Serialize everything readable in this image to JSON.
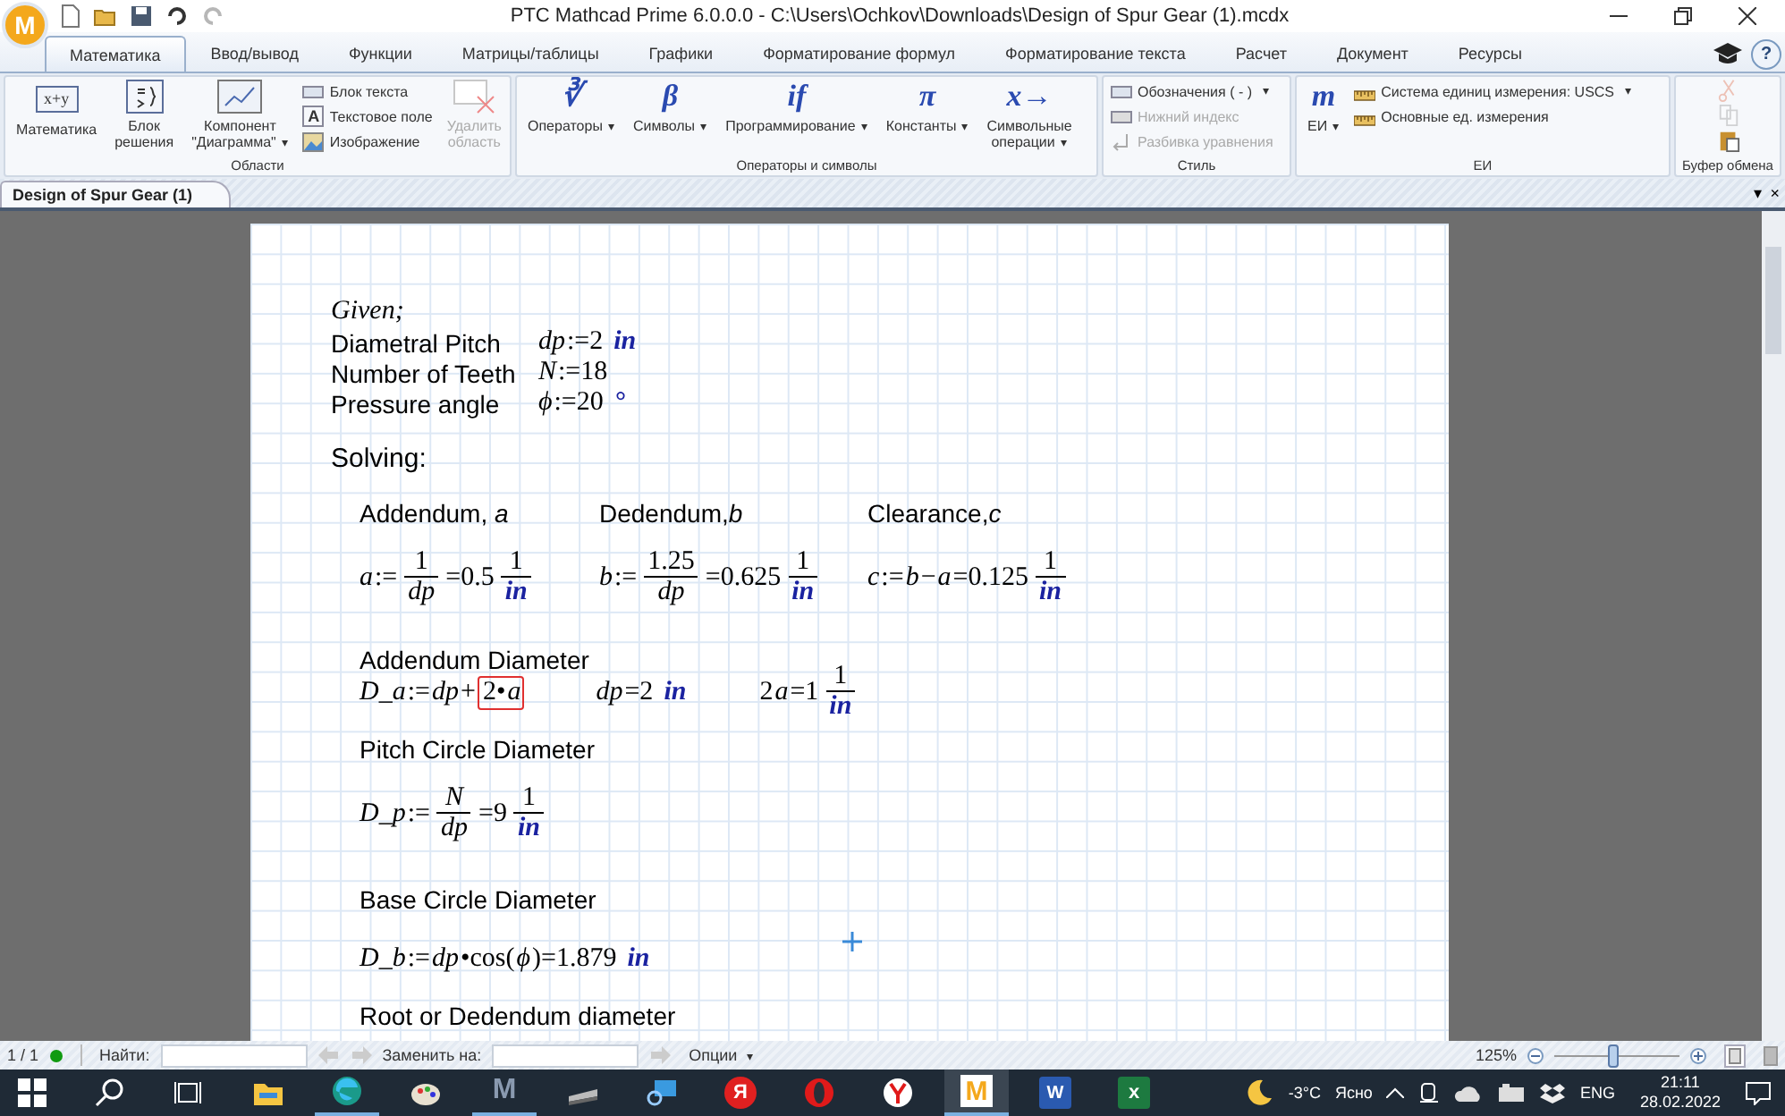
{
  "title_bar": {
    "app_logo": "M",
    "title": "PTC Mathcad Prime 6.0.0.0 - C:\\Users\\Ochkov\\Downloads\\Design of Spur Gear (1).mcdx",
    "quick_access": [
      {
        "kind": "new",
        "disabled": false
      },
      {
        "kind": "open",
        "disabled": false
      },
      {
        "kind": "save",
        "disabled": false
      },
      {
        "kind": "undo",
        "disabled": false
      },
      {
        "kind": "redo",
        "disabled": true
      }
    ]
  },
  "ribbon_tabs": [
    {
      "label": "Математика",
      "selected": true
    },
    {
      "label": "Ввод/вывод",
      "selected": false
    },
    {
      "label": "Функции",
      "selected": false
    },
    {
      "label": "Матрицы/таблицы",
      "selected": false
    },
    {
      "label": "Графики",
      "selected": false
    },
    {
      "label": "Форматирование формул",
      "selected": false
    },
    {
      "label": "Форматирование текста",
      "selected": false
    },
    {
      "label": "Расчет",
      "selected": false
    },
    {
      "label": "Документ",
      "selected": false
    },
    {
      "label": "Ресурсы",
      "selected": false
    }
  ],
  "help": "?",
  "ribbon_groups": [
    {
      "title": "Области",
      "items": [
        {
          "kind": "large",
          "label": "Математика",
          "glyph": "x+y",
          "disabled": false
        },
        {
          "kind": "large",
          "label": "Блок\nрешения",
          "disabled": false
        },
        {
          "kind": "large",
          "label": "Компонент\n\"Диаграмма\"",
          "caret": "▾",
          "disabled": false
        },
        {
          "kind": "small",
          "rows": [
            {
              "label": "Блок текста",
              "disabled": false
            },
            {
              "label": "Текстовое поле",
              "glyph": "A",
              "disabled": false
            },
            {
              "label": "Изображение",
              "disabled": false
            }
          ]
        },
        {
          "kind": "large",
          "label": "Удалить\nобласть",
          "disabled": true
        }
      ]
    },
    {
      "title": "Операторы и символы",
      "items": [
        {
          "kind": "large",
          "label": "Операторы",
          "glyph": "∛",
          "caret": "▾",
          "disabled": false
        },
        {
          "kind": "large",
          "label": "Символы",
          "glyph": "β",
          "caret": "▾",
          "disabled": false
        },
        {
          "kind": "large",
          "label": "Программирование",
          "glyph": "if",
          "caret": "▾",
          "disabled": false
        },
        {
          "kind": "large",
          "label": "Константы",
          "glyph": "π",
          "caret": "▾",
          "disabled": false
        },
        {
          "kind": "large",
          "label": "Символьные\nоперации",
          "glyph": "x→",
          "caret": "▾",
          "disabled": false
        }
      ]
    },
    {
      "title": "Стиль",
      "items": [
        {
          "kind": "small",
          "rows": [
            {
              "label": "Обозначения  ( - )",
              "caret": "▾",
              "disabled": false
            },
            {
              "label": "Нижний индекс",
              "disabled": true
            },
            {
              "label": "Разбивка уравнения",
              "disabled": true
            }
          ]
        }
      ]
    },
    {
      "title": "ЕИ",
      "items": [
        {
          "kind": "large",
          "label": "ЕИ",
          "glyph": "m",
          "caret": "▾",
          "disabled": false
        },
        {
          "kind": "small",
          "rows": [
            {
              "label": "Система единиц измерения:  USCS",
              "caret": "▾",
              "disabled": false
            },
            {
              "label": "Основные ед. измерения",
              "disabled": false
            }
          ]
        }
      ]
    },
    {
      "title": "Буфер обмена",
      "items": [
        {
          "kind": "icons",
          "rows": [
            {
              "disabled": true
            },
            {
              "disabled": true
            },
            {
              "disabled": false
            }
          ]
        }
      ]
    }
  ],
  "document_tabs": [
    {
      "label": "Design of Spur Gear (1)",
      "selected": true
    }
  ],
  "document_tab_menu": "▾",
  "document_tab_close": "×",
  "worksheet": {
    "blocks": [
      {
        "kind": "given",
        "text": "Given;"
      },
      {
        "kind": "definitions",
        "rows": [
          {
            "label": "Diametral Pitch",
            "expr": [
              {
                "kind": "var",
                "text": "dp"
              },
              {
                "kind": "num",
                "text": ":=2"
              },
              {
                "kind": "unit",
                "text": "in"
              }
            ]
          },
          {
            "label": "Number of Teeth",
            "expr": [
              {
                "kind": "var",
                "text": "N"
              },
              {
                "kind": "num",
                "text": ":=18"
              }
            ]
          },
          {
            "label": "Pressure angle",
            "expr": [
              {
                "kind": "var",
                "text": "ϕ"
              },
              {
                "kind": "num",
                "text": ":=20"
              },
              {
                "kind": "unit",
                "text": "°"
              }
            ]
          }
        ]
      },
      {
        "kind": "heading",
        "text": "Solving:"
      },
      {
        "kind": "columns",
        "columns": [
          {
            "title": "Addendum, *a*",
            "expr": [
              {
                "kind": "var",
                "text": "a"
              },
              {
                "kind": "num",
                "text": ":="
              },
              {
                "kind": "frac",
                "num": {
                  "kind": "num",
                  "text": "1"
                },
                "den": {
                  "kind": "var",
                  "text": "dp"
                }
              },
              {
                "kind": "num",
                "text": "=0.5"
              },
              {
                "kind": "frac",
                "num": {
                  "kind": "num",
                  "text": "1"
                },
                "den": {
                  "kind": "unit",
                  "text": "in"
                }
              }
            ]
          },
          {
            "title": "Dedendum,*b*",
            "expr": [
              {
                "kind": "var",
                "text": "b"
              },
              {
                "kind": "num",
                "text": ":="
              },
              {
                "kind": "frac",
                "num": {
                  "kind": "num",
                  "text": "1.25"
                },
                "den": {
                  "kind": "var",
                  "text": "dp"
                }
              },
              {
                "kind": "num",
                "text": "=0.625"
              },
              {
                "kind": "frac",
                "num": {
                  "kind": "num",
                  "text": "1"
                },
                "den": {
                  "kind": "unit",
                  "text": "in"
                }
              }
            ]
          },
          {
            "title": "Clearance,*c*",
            "expr": [
              {
                "kind": "var",
                "text": "c"
              },
              {
                "kind": "num",
                "text": ":="
              },
              {
                "kind": "var",
                "text": "b"
              },
              {
                "kind": "num",
                "text": "−"
              },
              {
                "kind": "var",
                "text": "a"
              },
              {
                "kind": "num",
                "text": "=0.125"
              },
              {
                "kind": "frac",
                "num": {
                  "kind": "num",
                  "text": "1"
                },
                "den": {
                  "kind": "unit",
                  "text": "in"
                }
              }
            ]
          }
        ]
      },
      {
        "kind": "section",
        "title": "Addendum Diameter",
        "exprs": [
          [
            {
              "kind": "var",
              "text": "D_a"
            },
            {
              "kind": "num",
              "text": ":="
            },
            {
              "kind": "var",
              "text": "dp"
            },
            {
              "kind": "num",
              "text": "+"
            },
            {
              "kind": "box",
              "items": [
                {
                  "kind": "num",
                  "text": "2•"
                },
                {
                  "kind": "var",
                  "text": "a"
                }
              ]
            }
          ],
          [
            {
              "kind": "var",
              "text": "dp"
            },
            {
              "kind": "num",
              "text": "=2"
            },
            {
              "kind": "unit",
              "text": "in"
            }
          ],
          [
            {
              "kind": "num",
              "text": "2 "
            },
            {
              "kind": "var",
              "text": "a"
            },
            {
              "kind": "num",
              "text": "=1"
            },
            {
              "kind": "frac",
              "num": {
                "kind": "num",
                "text": "1"
              },
              "den": {
                "kind": "unit",
                "text": "in"
              }
            }
          ]
        ]
      },
      {
        "kind": "section",
        "title": "Pitch Circle Diameter",
        "exprs": [
          [
            {
              "kind": "var",
              "text": "D_p"
            },
            {
              "kind": "num",
              "text": ":="
            },
            {
              "kind": "frac",
              "num": {
                "kind": "var",
                "text": "N"
              },
              "den": {
                "kind": "var",
                "text": "dp"
              }
            },
            {
              "kind": "num",
              "text": "=9"
            },
            {
              "kind": "frac",
              "num": {
                "kind": "num",
                "text": "1"
              },
              "den": {
                "kind": "unit",
                "text": "in"
              }
            }
          ]
        ]
      },
      {
        "kind": "section",
        "title": "Base Circle Diameter",
        "exprs": [
          [
            {
              "kind": "var",
              "text": "D_b"
            },
            {
              "kind": "num",
              "text": ":="
            },
            {
              "kind": "var",
              "text": "dp"
            },
            {
              "kind": "num",
              "text": "•cos("
            },
            {
              "kind": "var",
              "text": "ϕ"
            },
            {
              "kind": "num",
              "text": ")=1.879"
            },
            {
              "kind": "unit",
              "text": "in"
            }
          ]
        ]
      },
      {
        "kind": "section",
        "title": "Root or Dedendum diameter"
      }
    ]
  },
  "status_bar": {
    "pages": "1 / 1",
    "calc_ok": true,
    "find_label": "Найти:",
    "replace_label": "Заменить на:",
    "options": "Опции",
    "options_caret": "▾",
    "zoom": "125%",
    "zoom_slider": {
      "level": 0.47
    }
  },
  "taskbar": {
    "apps": [
      {
        "kind": "start",
        "running": false,
        "active": false
      },
      {
        "kind": "search",
        "running": false,
        "active": false
      },
      {
        "kind": "taskview",
        "running": false,
        "active": false
      },
      {
        "kind": "explorer",
        "running": false,
        "active": false
      },
      {
        "kind": "edge",
        "running": true,
        "active": false
      },
      {
        "kind": "paint",
        "running": false,
        "active": false
      },
      {
        "kind": "letter",
        "glyph": "M",
        "running": true,
        "active": false
      },
      {
        "kind": "scanner",
        "running": false,
        "active": false
      },
      {
        "kind": "remote",
        "running": false,
        "active": false
      },
      {
        "kind": "badge-red",
        "glyph": "Я",
        "running": false,
        "active": false
      },
      {
        "kind": "opera",
        "running": false,
        "active": false
      },
      {
        "kind": "ybrowser",
        "running": false,
        "active": false
      },
      {
        "kind": "mathcad",
        "glyph": "M",
        "running": true,
        "active": true
      },
      {
        "kind": "word",
        "glyph": "W",
        "running": false,
        "active": false
      },
      {
        "kind": "excel",
        "glyph": "x",
        "running": false,
        "active": false
      }
    ],
    "temperature": "-3°C",
    "weather": "Ясно",
    "language": "ENG",
    "time": "21:11",
    "date": "28.02.2022"
  }
}
